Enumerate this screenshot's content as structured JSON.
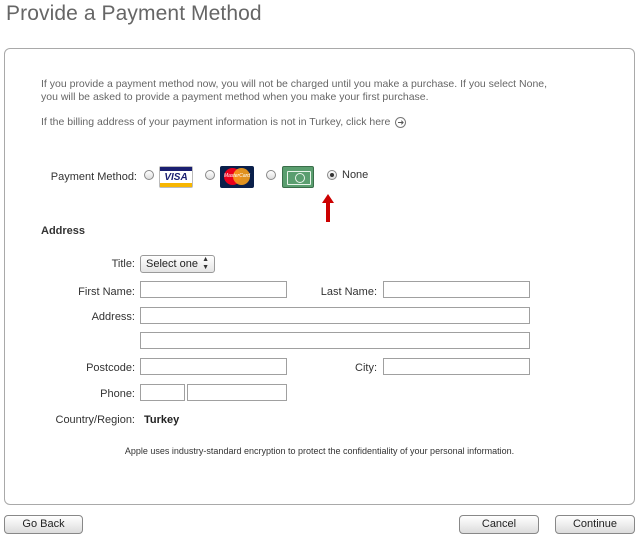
{
  "page": {
    "title": "Provide a Payment Method"
  },
  "intro": {
    "text": "If you provide a payment method now, you will not be charged until you make a purchase. If you select None, you will be asked to provide a payment method when you make your first purchase.",
    "billing_text": "If the billing address of your payment information is not in Turkey, click here",
    "billing_icon": "circle-arrow-right-icon"
  },
  "payment": {
    "label": "Payment Method:",
    "options": [
      {
        "name": "visa",
        "text": "VISA",
        "selected": false
      },
      {
        "name": "mastercard",
        "text": "MasterCard",
        "selected": false
      },
      {
        "name": "american-express",
        "text": "",
        "selected": false
      },
      {
        "name": "none",
        "text": "None",
        "selected": true
      }
    ],
    "annotation_icon": "red-up-arrow-icon",
    "annotation_color": "#cc0000"
  },
  "address": {
    "heading": "Address",
    "title_label": "Title:",
    "title_value": "Select one",
    "first_name_label": "First Name:",
    "last_name_label": "Last Name:",
    "address_label": "Address:",
    "postcode_label": "Postcode:",
    "city_label": "City:",
    "phone_label": "Phone:",
    "country_label": "Country/Region:",
    "country_value": "Turkey"
  },
  "security_note": "Apple uses industry-standard encryption to protect the confidentiality of your personal information.",
  "buttons": {
    "back": "Go Back",
    "cancel": "Cancel",
    "continue": "Continue"
  }
}
